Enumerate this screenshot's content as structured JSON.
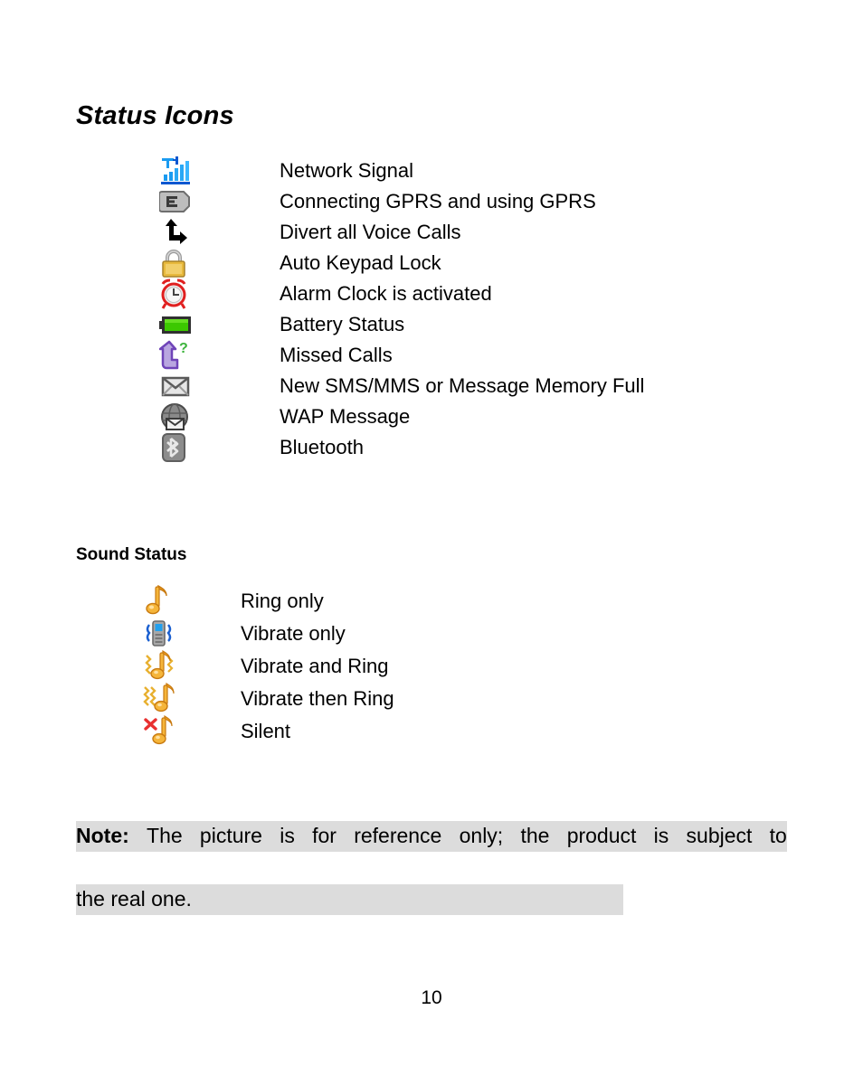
{
  "document": {
    "page_number": "10",
    "headings": {
      "status_icons": "Status Icons",
      "sound_status": "Sound Status"
    }
  },
  "status_icons": {
    "items": [
      {
        "icon": "network-signal-icon",
        "label": "Network Signal"
      },
      {
        "icon": "gprs-edge-icon",
        "label": "Connecting GPRS and using GPRS"
      },
      {
        "icon": "call-divert-icon",
        "label": "Divert all Voice Calls"
      },
      {
        "icon": "keypad-lock-icon",
        "label": "Auto Keypad Lock"
      },
      {
        "icon": "alarm-clock-icon",
        "label": "Alarm Clock is activated"
      },
      {
        "icon": "battery-icon",
        "label": "Battery Status"
      },
      {
        "icon": "missed-call-icon",
        "label": "Missed Calls"
      },
      {
        "icon": "envelope-icon",
        "label": "New SMS/MMS or Message Memory Full"
      },
      {
        "icon": "wap-message-icon",
        "label": "WAP Message"
      },
      {
        "icon": "bluetooth-icon",
        "label": "Bluetooth"
      }
    ]
  },
  "sound_status": {
    "items": [
      {
        "icon": "music-note-icon",
        "label": "Ring only"
      },
      {
        "icon": "vibrate-phone-icon",
        "label": "Vibrate only"
      },
      {
        "icon": "vibrate-and-ring-icon",
        "label": "Vibrate and Ring"
      },
      {
        "icon": "vibrate-then-ring-icon",
        "label": "Vibrate then Ring"
      },
      {
        "icon": "silent-icon",
        "label": "Silent"
      }
    ]
  },
  "note": {
    "prefix": "Note:",
    "line1_words": [
      "The",
      "picture",
      "is",
      "for",
      "reference",
      "only;",
      "the",
      "product",
      "is",
      "subject",
      "to"
    ],
    "line2": "the real one.",
    "highlight_color": "#dcdcdc"
  },
  "colors": {
    "signal_blue": "#1a9bf0",
    "signal_dark_blue": "#0a57d0",
    "badge_gray": "#b4b4b4",
    "lock_gold": "#e8b93c",
    "alarm_red": "#e02020",
    "battery_green": "#3cc800",
    "missed_purple": "#7a52c8",
    "missed_green": "#3cb43c",
    "note_orange": "#f0a020",
    "silent_red": "#e83030",
    "vibrate_blue": "#1a5fd0",
    "text_black": "#000000"
  }
}
